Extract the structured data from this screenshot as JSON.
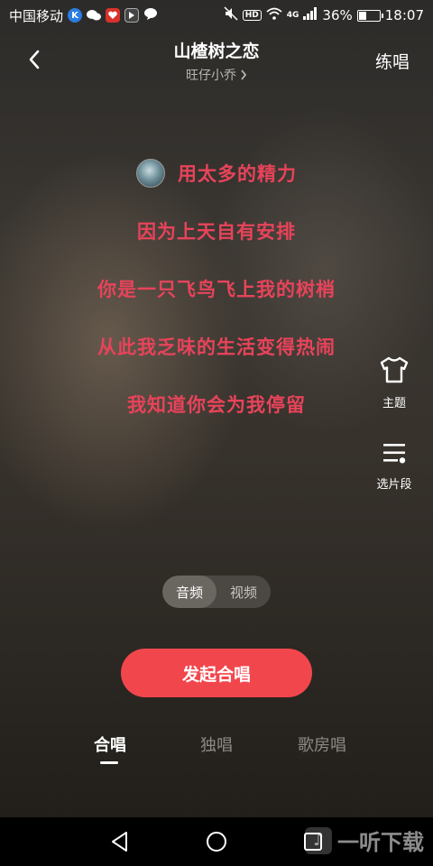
{
  "status_bar": {
    "carrier": "中国移动",
    "network": "4G",
    "hd_label": "HD",
    "battery": "36%",
    "time": "18:07"
  },
  "header": {
    "title": "山楂树之恋",
    "artist": "旺仔小乔",
    "practice_label": "练唱"
  },
  "lyrics": {
    "lines": [
      "用太多的精力",
      "因为上天自有安排",
      "你是一只飞鸟飞上我的树梢",
      "从此我乏味的生活变得热闹",
      "我知道你会为我停留"
    ]
  },
  "side_tools": {
    "theme_label": "主题",
    "segment_label": "选片段"
  },
  "mode_toggle": {
    "audio_label": "音频",
    "video_label": "视频"
  },
  "cta": {
    "label": "发起合唱"
  },
  "tabs": {
    "chorus": "合唱",
    "solo": "独唱",
    "room": "歌房唱"
  },
  "watermark": {
    "text": "一听下载"
  },
  "colors": {
    "lyric": "#e8435a",
    "cta": "#f2464d"
  }
}
